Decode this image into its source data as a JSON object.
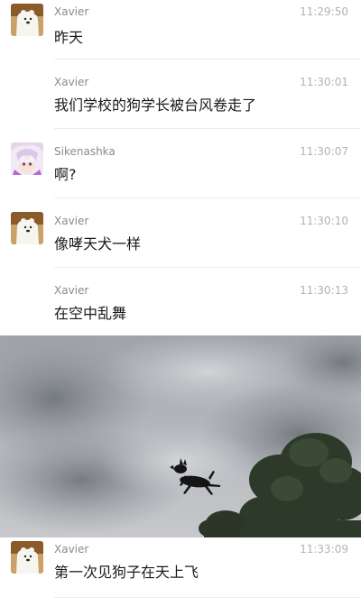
{
  "messages": [
    {
      "sender": "Xavier",
      "time": "11:29:50",
      "text": "昨天",
      "avatar": "polar-bear-avatar"
    },
    {
      "sender": "Xavier",
      "time": "11:30:01",
      "text": "我们学校的狗学长被台风卷走了",
      "avatar": ""
    },
    {
      "sender": "Sikenashka",
      "time": "11:30:07",
      "text": "啊?",
      "avatar": "anime-character-avatar"
    },
    {
      "sender": "Xavier",
      "time": "11:30:10",
      "text": "像哮天犬一样",
      "avatar": "polar-bear-avatar"
    },
    {
      "sender": "Xavier",
      "time": "11:30:13",
      "text": "在空中乱舞",
      "avatar": ""
    },
    {
      "sender": "Xavier",
      "time": "11:33:09",
      "text": "第一次见狗子在天上飞",
      "avatar": "polar-bear-avatar"
    }
  ],
  "photo": {
    "subject": "black dog flying in stormy sky above trees"
  },
  "colors": {
    "background": "#ffffff",
    "sender_text": "#8a8a8a",
    "time_text": "#b3b3b3",
    "message_text": "#1a1a1a",
    "divider": "#ececec"
  }
}
